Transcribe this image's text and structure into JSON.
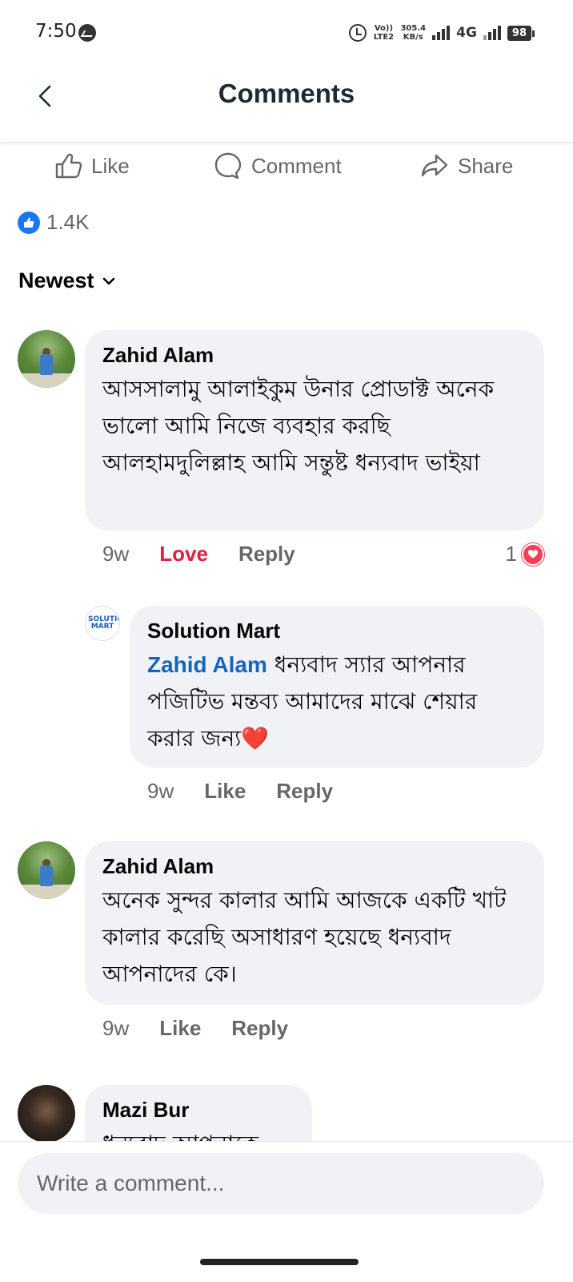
{
  "status_bar": {
    "time": "7:50",
    "volte": "Vo)) LTE2",
    "speed_value": "305.4",
    "speed_unit": "KB/s",
    "network": "4G",
    "battery": "98"
  },
  "header": {
    "title": "Comments"
  },
  "actions": {
    "like": "Like",
    "comment": "Comment",
    "share": "Share"
  },
  "reactions": {
    "count": "1.4K"
  },
  "sort": {
    "label": "Newest"
  },
  "comments": [
    {
      "name": "Zahid Alam",
      "text": "আসসালামু আলাইকুম উনার প্রোডাক্ট অনেক ভালো আমি নিজে ব্যবহার করছি আলহামদুলিল্লাহ আমি সন্তুষ্ট ধন্যবাদ ভাইয়া",
      "time": "9w",
      "reaction_label": "Love",
      "reply_label": "Reply",
      "reaction_count": "1"
    },
    {
      "name": "Solution Mart",
      "avatar_text": "SOLUTION MART",
      "tag": "Zahid Alam",
      "text": " ধন্যবাদ স্যার আপনার পজিটিভ মন্তব্য আমাদের মাঝে শেয়ার করার জন্য",
      "emoji": "❤️",
      "time": "9w",
      "like_label": "Like",
      "reply_label": "Reply"
    },
    {
      "name": "Zahid Alam",
      "text": "অনেক সুন্দর কালার আমি আজকে একটি খাট কালার করেছি অসাধারণ হয়েছে ধন্যবাদ আপনাদের কে।",
      "time": "9w",
      "like_label": "Like",
      "reply_label": "Reply"
    },
    {
      "name": "Mazi Bur",
      "text": "ধন্যবাদ আপনাকে"
    }
  ],
  "composer": {
    "placeholder": "Write a comment..."
  },
  "colors": {
    "brand_blue": "#1877f2",
    "love_red": "#e41e3f",
    "bubble_bg": "#f0f2f5",
    "tag_blue": "#1565c0"
  },
  "icons": [
    "back-icon",
    "like-icon",
    "comment-icon",
    "share-icon",
    "chevron-down-icon",
    "heart-icon"
  ]
}
